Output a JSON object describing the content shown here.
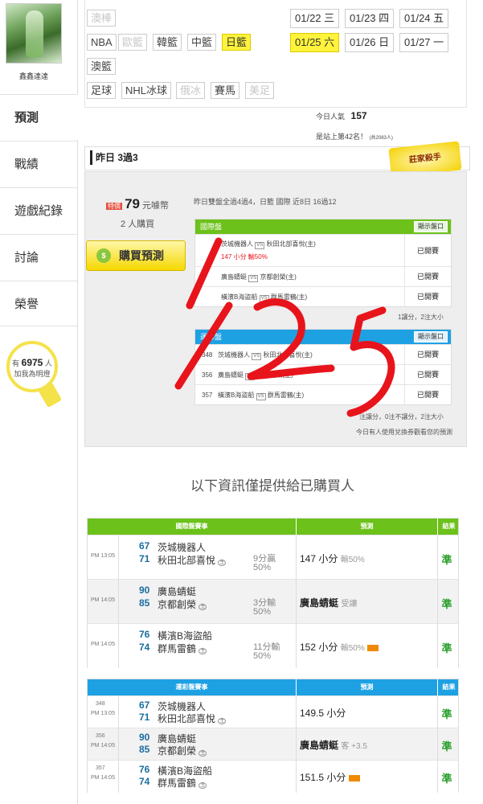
{
  "user": {
    "name": "鑫鑫達達"
  },
  "sidebar": {
    "items": [
      {
        "label": "預測"
      },
      {
        "label": "戰績"
      },
      {
        "label": "遊戲紀錄"
      },
      {
        "label": "討論"
      },
      {
        "label": "榮譽"
      }
    ],
    "lightbulb": {
      "prefix": "有",
      "count": "6975",
      "suffix": "人",
      "caption": "加我為明燈"
    }
  },
  "league_filters": {
    "row1": [
      "澳棒"
    ],
    "row2": [
      "NBA",
      "歐籃",
      "韓籃",
      "中籃",
      "日籃"
    ],
    "row3": [
      "澳籃"
    ],
    "row4": [
      "足球",
      "NHL冰球",
      "俄冰",
      "賽馬",
      "美足"
    ]
  },
  "dates": {
    "row1": [
      {
        "d": "01/22",
        "w": "三"
      },
      {
        "d": "01/23",
        "w": "四"
      },
      {
        "d": "01/24",
        "w": "五"
      }
    ],
    "row2": [
      {
        "d": "01/25",
        "w": "六"
      },
      {
        "d": "01/26",
        "w": "日"
      },
      {
        "d": "01/27",
        "w": "一"
      }
    ]
  },
  "stats": {
    "popularity_label": "今日人氣",
    "popularity_value": "157",
    "rank_text": "是站上第42名！",
    "rank_small": "(共2083人)"
  },
  "yesterday": {
    "label": "昨日 3過3"
  },
  "badge": {
    "text": "莊家殺手"
  },
  "purchase": {
    "hot_tag": "特價",
    "price": "79",
    "currency": "元噱幣",
    "buyers": "2 人購買",
    "button": "購買預測"
  },
  "summary_text": "昨日雙盤全過4過4，日籃 國際 近8日 16過12",
  "intl_block": {
    "title": "國際盤",
    "show_btn": "顯示盤口",
    "rows": [
      {
        "away": "茨城機器人",
        "home": "秋田北部喜悅(主)",
        "status": "已開賽",
        "sub": "147 小分 輸50%"
      },
      {
        "away": "廣島蜻蜓",
        "home": "京都創榮(主)",
        "status": "已開賽"
      },
      {
        "away": "橫濱B海盜船",
        "home": "群馬雷鶴(主)",
        "status": "已開賽"
      }
    ],
    "note": "1讓分，2注大小"
  },
  "tw_block": {
    "title": "運彩盤",
    "show_btn": "顯示盤口",
    "rows": [
      {
        "no": "348",
        "away": "茨城機器人",
        "home": "秋田北部喜悅(主)",
        "status": "已開賽"
      },
      {
        "no": "356",
        "away": "廣島蜻蜓",
        "home": "京都創榮(主)",
        "status": "已開賽"
      },
      {
        "no": "357",
        "away": "橫濱B海盜船",
        "home": "群馬雷鶴(主)",
        "status": "已開賽"
      }
    ],
    "note": "注讓分，0注不讓分，2注大小",
    "footer": "今日有人使用兌換券觀看您的預測"
  },
  "info_heading": "以下資訊僅提供給已購買人",
  "intl_table": {
    "headers": [
      "國際盤賽事",
      "預測",
      "結果"
    ],
    "rows": [
      {
        "time": "PM 13:05",
        "s1": "67",
        "t1": "茨城機器人",
        "s2": "71",
        "t2": "秋田北部喜悅",
        "odds": "9分贏",
        "pct": "50%",
        "pick": "147 小分",
        "pick_note": "輸50%",
        "result": "準"
      },
      {
        "time": "PM 14:05",
        "s1": "90",
        "t1": "廣島蜻蜓",
        "s2": "85",
        "t2": "京都創榮",
        "odds": "3分輸",
        "pct": "50%",
        "pick": "廣島蜻蜓",
        "pick_note": "受讓",
        "result": "準"
      },
      {
        "time": "PM 14:05",
        "s1": "76",
        "t1": "橫濱B海盜船",
        "s2": "74",
        "t2": "群馬雷鶴",
        "odds": "11分輸",
        "pct": "50%",
        "pick": "152 小分",
        "pick_note": "輸50%",
        "result": "準"
      }
    ]
  },
  "tw_table": {
    "headers": [
      "運彩盤賽事",
      "預測",
      "結果"
    ],
    "rows": [
      {
        "no": "348",
        "time": "PM 13:05",
        "s1": "67",
        "t1": "茨城機器人",
        "s2": "71",
        "t2": "秋田北部喜悅",
        "pick": "149.5 小分",
        "pick_note": "",
        "result": "準"
      },
      {
        "no": "356",
        "time": "PM 14:05",
        "s1": "90",
        "t1": "廣島蜻蜓",
        "s2": "85",
        "t2": "京都創榮",
        "pick": "廣島蜻蜓",
        "pick_note": "客 +3.5",
        "result": "準"
      },
      {
        "no": "357",
        "time": "PM 14:05",
        "s1": "76",
        "t1": "橫濱B海盜船",
        "s2": "74",
        "t2": "群馬雷鶴",
        "pick": "151.5 小分",
        "pick_note": "",
        "result": "準"
      }
    ]
  },
  "handwriting": "1/25",
  "colors": {
    "green": "#6cc11a",
    "blue": "#1ea1e3",
    "yellow": "#fff33c",
    "ink": "#e8141b"
  }
}
